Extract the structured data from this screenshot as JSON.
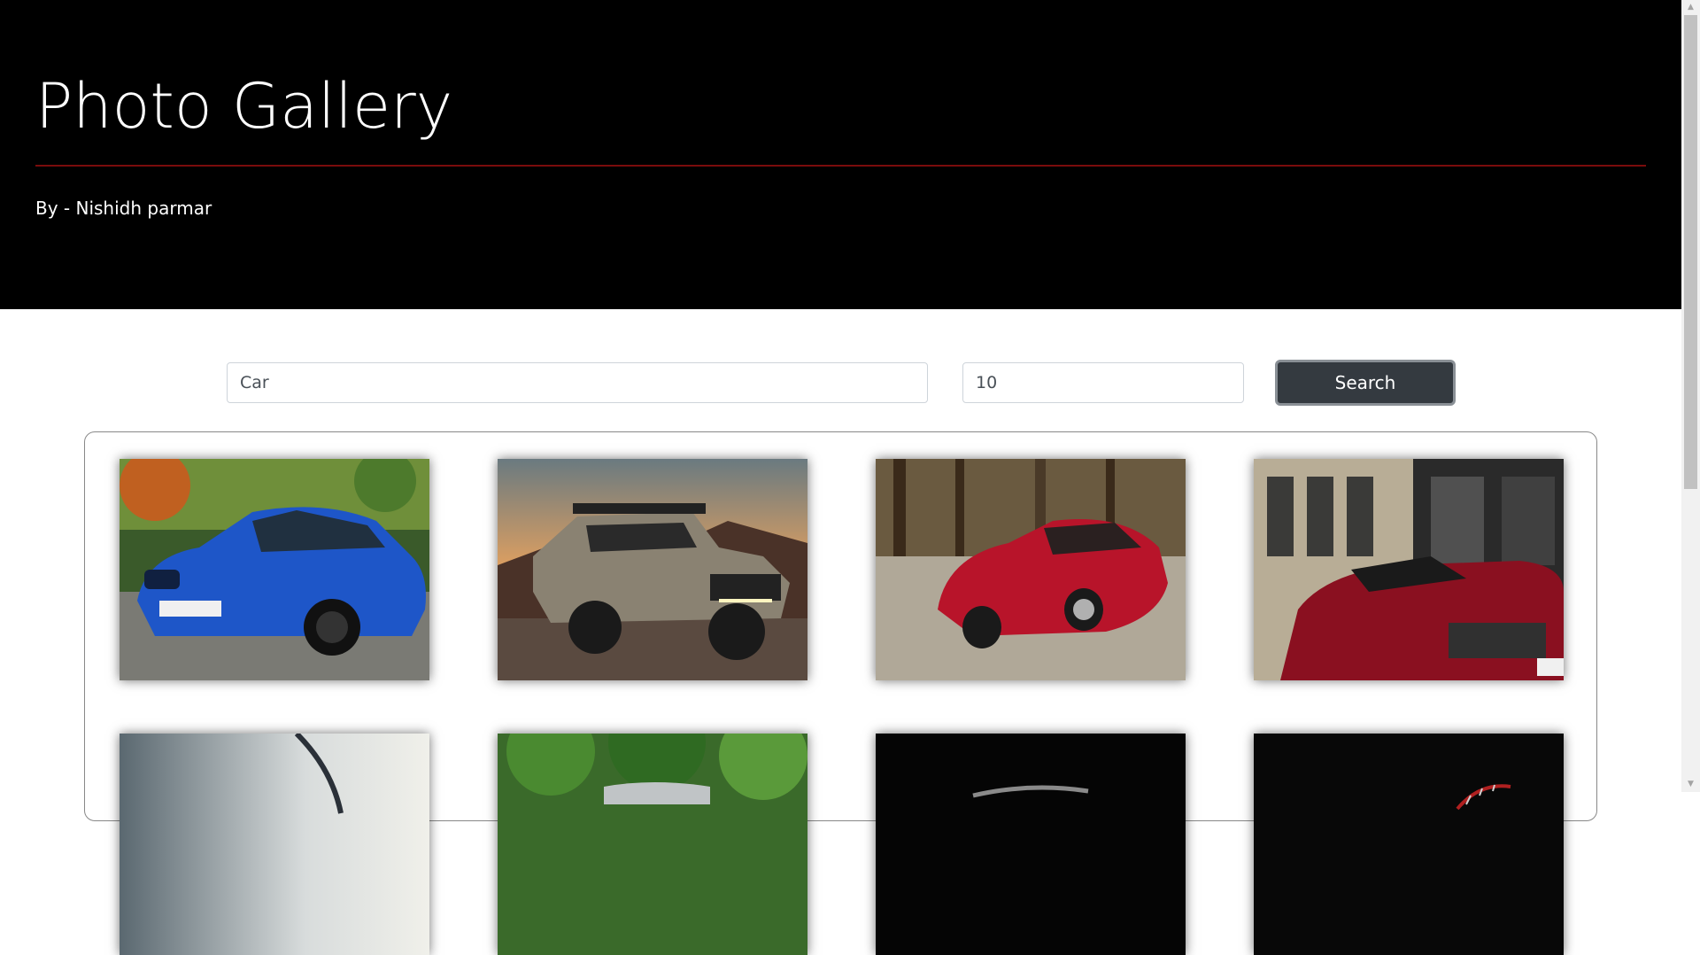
{
  "header": {
    "title": "Photo Gallery",
    "byline": "By - Nishidh parmar",
    "accent_color": "#7a0c0c"
  },
  "search": {
    "query_value": "Car",
    "count_value": "10",
    "button_label": "Search"
  },
  "gallery": {
    "photos": [
      {
        "subject": "blue-bmw-sedan"
      },
      {
        "subject": "toyota-tacoma-offroad-truck"
      },
      {
        "subject": "red-alfa-romeo-sports-car"
      },
      {
        "subject": "red-audi-r8-rear"
      },
      {
        "subject": "silver-car-hood-closeup"
      },
      {
        "subject": "car-among-trees"
      },
      {
        "subject": "dark-car-studio"
      },
      {
        "subject": "speedometer-dark"
      }
    ]
  },
  "scrollbar": {
    "up_icon": "scroll-up-arrow-icon",
    "down_icon": "scroll-down-arrow-icon"
  }
}
